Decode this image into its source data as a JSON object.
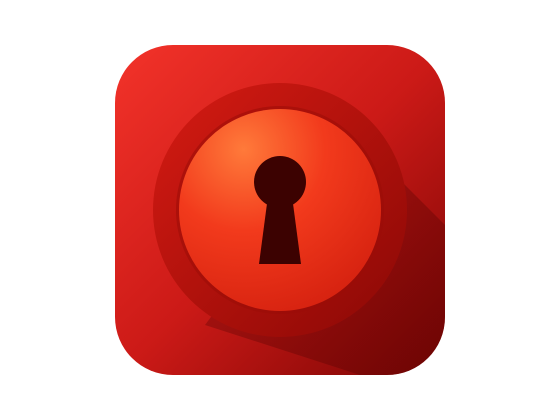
{
  "icon": {
    "name": "keyhole-lock-app-icon",
    "depicts": "keyhole-icon"
  },
  "colors": {
    "tile_light": "#f3332a",
    "tile_mid": "#cc1a17",
    "tile_dark": "#7a0504",
    "ring_light": "#d61b13",
    "ring_dark": "#8a0805",
    "disc_highlight": "#ff7a3a",
    "disc_mid": "#f23a1c",
    "disc_dark": "#d4200f",
    "keyhole": "#3c0201",
    "shadow": "#5a0302"
  }
}
